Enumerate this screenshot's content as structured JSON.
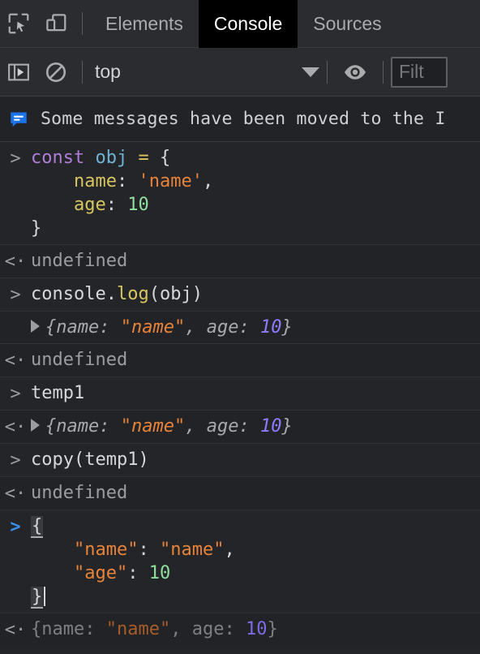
{
  "tabbar": {
    "inspect_icon": "inspect-element-icon",
    "device_icon": "device-toolbar-icon",
    "tabs": [
      {
        "label": "Elements",
        "active": false
      },
      {
        "label": "Console",
        "active": true
      },
      {
        "label": "Sources",
        "active": false
      }
    ]
  },
  "filterbar": {
    "sidebar_icon": "console-sidebar-icon",
    "clear_icon": "clear-console-icon",
    "context": "top",
    "context_caret": "chevron-down-icon",
    "eye_icon": "live-expression-eye-icon",
    "filter_placeholder": "Filt"
  },
  "banner": {
    "icon": "info-message-icon",
    "text": "Some messages have been moved to the I"
  },
  "console": {
    "prompt_in": ">",
    "prompt_out": "<·",
    "entries": [
      {
        "kind": "input",
        "lines": [
          {
            "tokens": [
              {
                "t": "const",
                "c": "kw"
              },
              {
                "t": " ",
                "c": "plain"
              },
              {
                "t": "obj",
                "c": "var"
              },
              {
                "t": " ",
                "c": "plain"
              },
              {
                "t": "=",
                "c": "op"
              },
              {
                "t": " {",
                "c": "plain"
              }
            ]
          },
          {
            "indent": 4,
            "tokens": [
              {
                "t": "name",
                "c": "prop"
              },
              {
                "t": ": ",
                "c": "plain"
              },
              {
                "t": "'name'",
                "c": "str"
              },
              {
                "t": ",",
                "c": "plain"
              }
            ]
          },
          {
            "indent": 4,
            "tokens": [
              {
                "t": "age",
                "c": "prop"
              },
              {
                "t": ": ",
                "c": "plain"
              },
              {
                "t": "10",
                "c": "num"
              }
            ]
          },
          {
            "tokens": [
              {
                "t": "}",
                "c": "plain"
              }
            ]
          }
        ]
      },
      {
        "kind": "output",
        "result": "undefined",
        "style": "undef"
      },
      {
        "kind": "input",
        "lines": [
          {
            "tokens": [
              {
                "t": "console.",
                "c": "plain"
              },
              {
                "t": "log",
                "c": "fn"
              },
              {
                "t": "(obj)",
                "c": "plain"
              }
            ]
          }
        ]
      },
      {
        "kind": "logged-object",
        "preview": {
          "open": "{",
          "key1": "name: ",
          "val1": "\"name\"",
          "sep": ", ",
          "key2": "age: ",
          "val2": "10",
          "close": "}"
        }
      },
      {
        "kind": "output",
        "result": "undefined",
        "style": "undef"
      },
      {
        "kind": "input",
        "lines": [
          {
            "tokens": [
              {
                "t": "temp1",
                "c": "plain"
              }
            ]
          }
        ]
      },
      {
        "kind": "output-object",
        "preview": {
          "open": "{",
          "key1": "name: ",
          "val1": "\"name\"",
          "sep": ", ",
          "key2": "age: ",
          "val2": "10",
          "close": "}"
        }
      },
      {
        "kind": "input",
        "lines": [
          {
            "tokens": [
              {
                "t": "copy(temp1)",
                "c": "plain"
              }
            ]
          }
        ]
      },
      {
        "kind": "output",
        "result": "undefined",
        "style": "undef"
      }
    ],
    "active_input": {
      "prompt": ">",
      "lines": [
        {
          "brace": "{"
        },
        {
          "indent": 4,
          "key": "\"name\"",
          "colon": ": ",
          "value": "\"name\"",
          "value_type": "str",
          "comma": ","
        },
        {
          "indent": 4,
          "key": "\"age\"",
          "colon": ": ",
          "value": "10",
          "value_type": "num",
          "comma": ""
        },
        {
          "brace": "}",
          "caret": true
        }
      ]
    },
    "eval_preview": {
      "prompt": "<·",
      "open": "{",
      "key1": "name: ",
      "val1": "\"name\"",
      "sep": ", ",
      "key2": "age: ",
      "val2": "10",
      "close": "}"
    }
  },
  "colors": {
    "background": "#222326",
    "panel": "#2b2c2f",
    "active_tab": "#000000",
    "accent_blue": "#3b8eea",
    "string": "#e8833a",
    "number": "#8fdfa0",
    "preview_number": "#8e7cff",
    "keyword": "#b07dd8"
  }
}
